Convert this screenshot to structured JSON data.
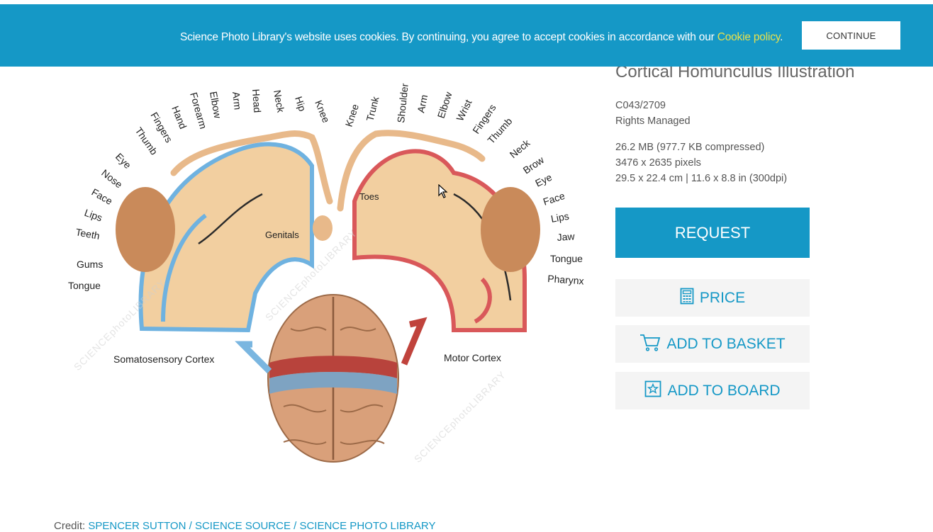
{
  "cookie_banner": {
    "message": "Science Photo Library's website uses cookies. By continuing, you agree to accept cookies in accordance with our ",
    "policy_link": "Cookie policy",
    "suffix": ".",
    "continue_label": "CONTINUE"
  },
  "image": {
    "labels_left": [
      "Toes",
      "Genitals",
      "Eye",
      "Nose",
      "Face",
      "Lips",
      "Teeth",
      "Gums",
      "Tongue",
      "Thumb",
      "Fingers",
      "Hand",
      "Forearm",
      "Elbow",
      "Arm",
      "Head",
      "Neck",
      "Hip",
      "Knee"
    ],
    "labels_right": [
      "Knee",
      "Trunk",
      "Shoulder",
      "Arm",
      "Elbow",
      "Wrist",
      "Fingers",
      "Thumb",
      "Neck",
      "Brow",
      "Eye",
      "Face",
      "Lips",
      "Jaw",
      "Tongue",
      "Pharynx"
    ],
    "left_caption": "Somatosensory Cortex",
    "right_caption": "Motor Cortex",
    "toes_label": "Toes",
    "genitals_label": "Genitals",
    "watermark": "SCIENCEphotoLIBRARY"
  },
  "product": {
    "title": "Cortical Homunculus Illustration",
    "id": "C043/2709",
    "license": "Rights Managed",
    "file_size": "26.2 MB (977.7 KB compressed)",
    "pixels": "3476 x 2635 pixels",
    "dimensions": "29.5 x 22.4 cm | 11.6 x 8.8 in (300dpi)"
  },
  "actions": {
    "request_label": "REQUEST",
    "price_label": "PRICE",
    "basket_label": "ADD TO BASKET",
    "board_label": "ADD TO BOARD"
  },
  "credit": {
    "prefix": "Credit: ",
    "text": "SPENCER SUTTON / SCIENCE SOURCE / SCIENCE PHOTO LIBRARY"
  },
  "colors": {
    "brand_blue": "#1598c6",
    "cookie_link": "#e8e14c"
  }
}
